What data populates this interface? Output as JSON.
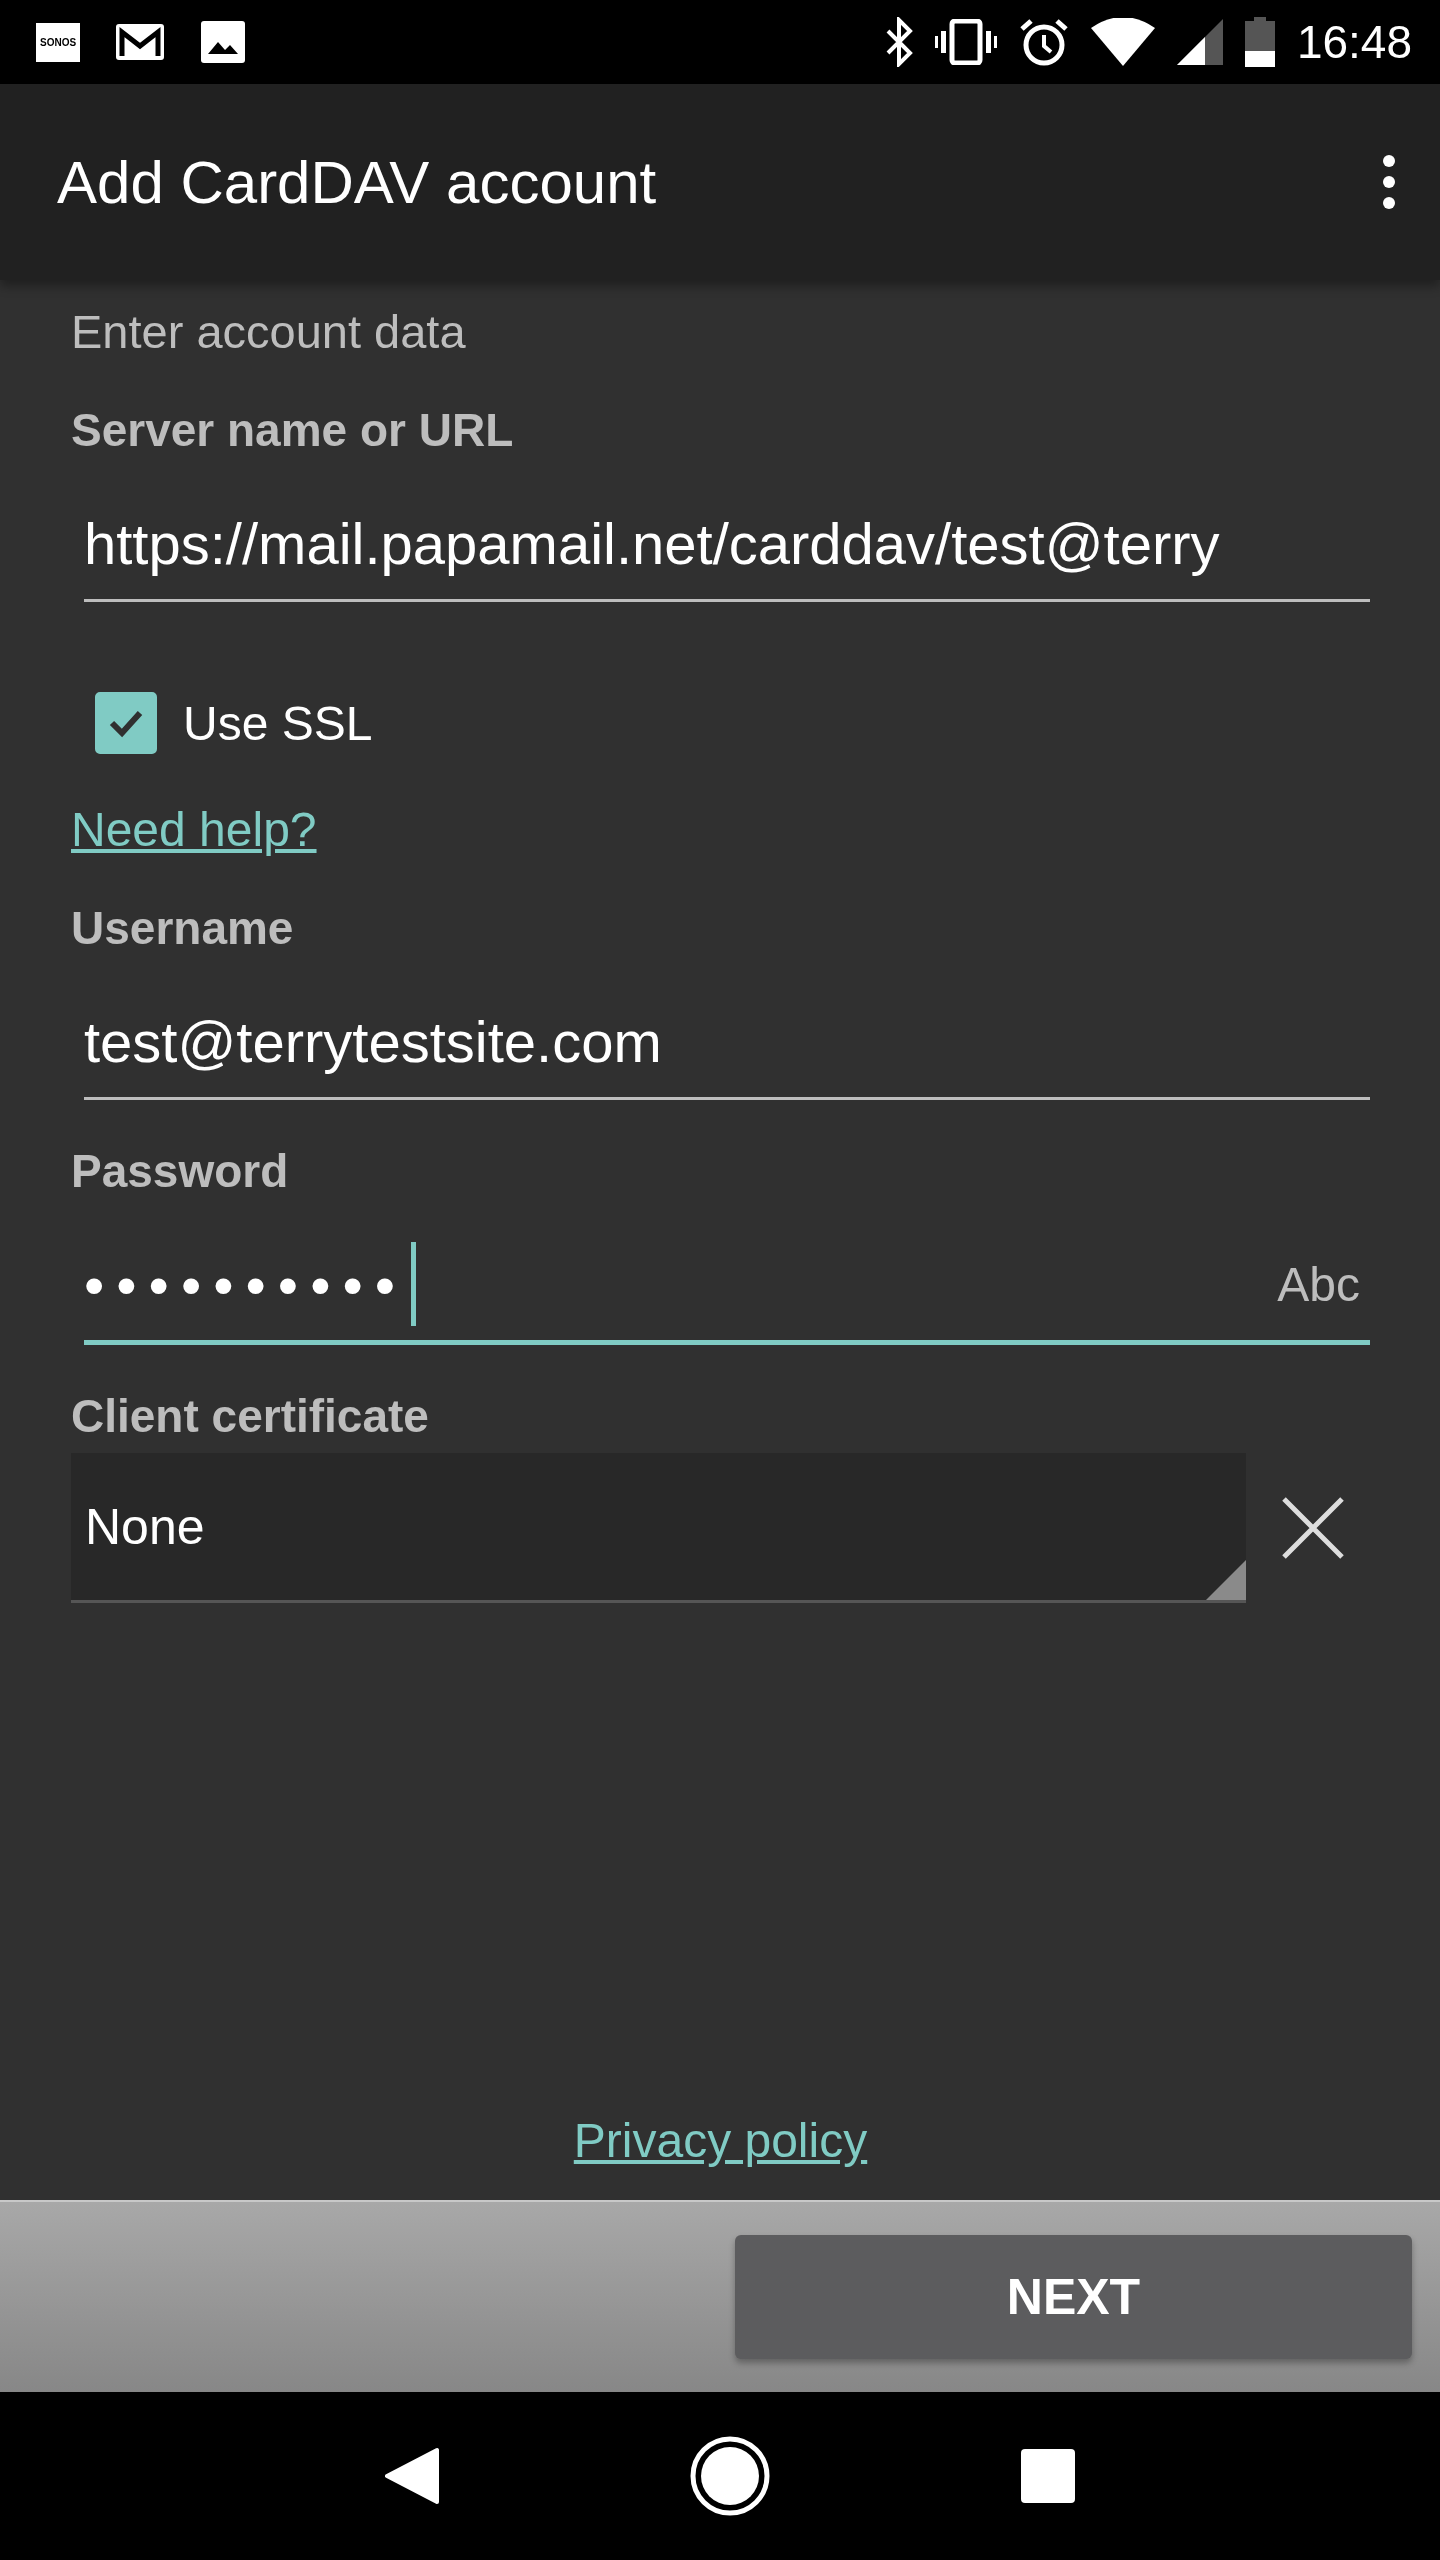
{
  "status_bar": {
    "app_badge": "SONOS",
    "time": "16:48"
  },
  "app_bar": {
    "title": "Add CardDAV account"
  },
  "section_title": "Enter account data",
  "fields": [
    {
      "kind": "text",
      "label": "Server name or URL",
      "value": "https://mail.papamail.net/carddav/test@terry",
      "focused": false
    },
    {
      "kind": "checkbox",
      "label": "Use SSL",
      "checked": true
    },
    {
      "kind": "link",
      "label": "Need help?"
    },
    {
      "kind": "text",
      "label": "Username",
      "value": "test@terrytestsite.com",
      "focused": false
    },
    {
      "kind": "password",
      "label": "Password",
      "value": "••••••••••",
      "input_hint": "Abc",
      "focused": true
    },
    {
      "kind": "select",
      "label": "Client certificate",
      "value": "None"
    }
  ],
  "privacy_link": "Privacy policy",
  "next_button": "NEXT"
}
